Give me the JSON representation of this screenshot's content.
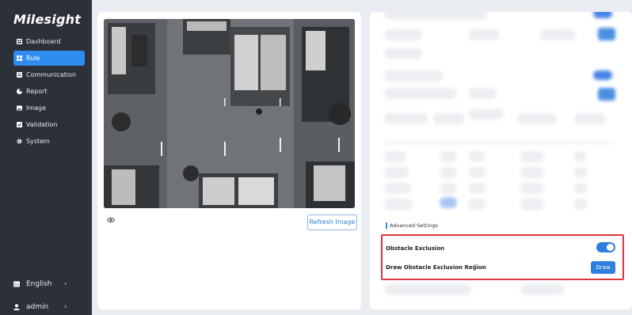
{
  "app": {
    "logo": "Milesight"
  },
  "sidebar": {
    "items": [
      {
        "label": "Dashboard",
        "icon": "dashboard-icon",
        "active": false
      },
      {
        "label": "Rule",
        "icon": "rule-icon",
        "active": true
      },
      {
        "label": "Communication",
        "icon": "communication-icon",
        "active": false
      },
      {
        "label": "Report",
        "icon": "report-icon",
        "active": false
      },
      {
        "label": "Image",
        "icon": "image-icon",
        "active": false
      },
      {
        "label": "Validation",
        "icon": "validation-icon",
        "active": false
      },
      {
        "label": "System",
        "icon": "gear-icon",
        "active": false
      }
    ],
    "language": {
      "label": "English",
      "chevron": "›"
    },
    "user": {
      "label": "admin",
      "chevron": "›"
    }
  },
  "camera": {
    "refresh_label": "Refresh Image",
    "eye_icon": "eye-icon"
  },
  "settings": {
    "section_title": "Advanced Settings",
    "obstacle_exclusion": {
      "label": "Obstacle Exclusion",
      "enabled": true
    },
    "draw_region": {
      "label": "Draw Obstacle Exclusion Region",
      "button_label": "Draw",
      "info_icon": "info-icon"
    }
  },
  "colors": {
    "accent": "#2f7fe0",
    "sidebar_bg": "#2c3039",
    "highlight": "#d9363e"
  }
}
